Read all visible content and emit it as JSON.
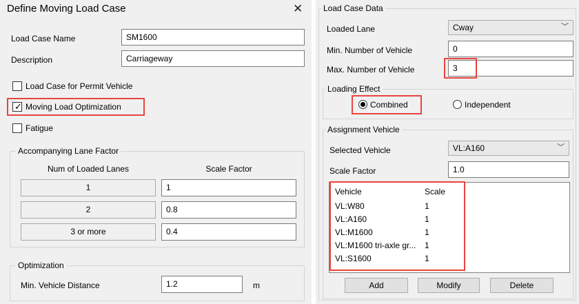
{
  "dialog": {
    "title": "Define Moving Load Case"
  },
  "load_case_name": {
    "label": "Load Case Name",
    "value": "SM1600"
  },
  "description": {
    "label": "Description",
    "value": "Carriageway"
  },
  "options": {
    "permit": {
      "label": "Load Case for Permit Vehicle",
      "checked": false
    },
    "optimization": {
      "label": "Moving Load Optimization",
      "checked": true
    },
    "fatigue": {
      "label": "Fatigue",
      "checked": false
    }
  },
  "lane_factor": {
    "title": "Accompanying Lane Factor",
    "col_lanes": "Num of Loaded Lanes",
    "col_scale": "Scale Factor",
    "rows": [
      {
        "lanes": "1",
        "scale": "1"
      },
      {
        "lanes": "2",
        "scale": "0.8"
      },
      {
        "lanes": "3 or more",
        "scale": "0.4"
      }
    ]
  },
  "optimization": {
    "title": "Optimization",
    "label": "Min. Vehicle Distance",
    "value": "1.2",
    "unit": "m"
  },
  "load_case_data": {
    "title": "Load Case Data",
    "loaded_lane": {
      "label": "Loaded Lane",
      "value": "Cway"
    },
    "min_vehicles": {
      "label": "Min. Number of Vehicle",
      "value": "0"
    },
    "max_vehicles": {
      "label": "Max. Number of Vehicle",
      "value": "3"
    }
  },
  "loading_effect": {
    "title": "Loading Effect",
    "combined": "Combined",
    "independent": "Independent",
    "selected": "Combined"
  },
  "assignment": {
    "title": "Assignment Vehicle",
    "selected_vehicle": {
      "label": "Selected Vehicle",
      "value": "VL:A160"
    },
    "scale_factor": {
      "label": "Scale Factor",
      "value": "1.0"
    },
    "columns": {
      "vehicle": "Vehicle",
      "scale": "Scale"
    },
    "rows": [
      {
        "vehicle": "VL:W80",
        "scale": "1"
      },
      {
        "vehicle": "VL:A160",
        "scale": "1"
      },
      {
        "vehicle": "VL:M1600",
        "scale": "1"
      },
      {
        "vehicle": "VL:M1600 tri-axle gr...",
        "scale": "1"
      },
      {
        "vehicle": "VL:S1600",
        "scale": "1"
      }
    ],
    "buttons": {
      "add": "Add",
      "modify": "Modify",
      "delete": "Delete"
    }
  },
  "colors": {
    "highlight": "#e8443f",
    "panel": "#f0f0f0"
  },
  "icons": {
    "close": "close-icon",
    "dropdown": "chevron-down-icon",
    "check": "check-icon"
  }
}
